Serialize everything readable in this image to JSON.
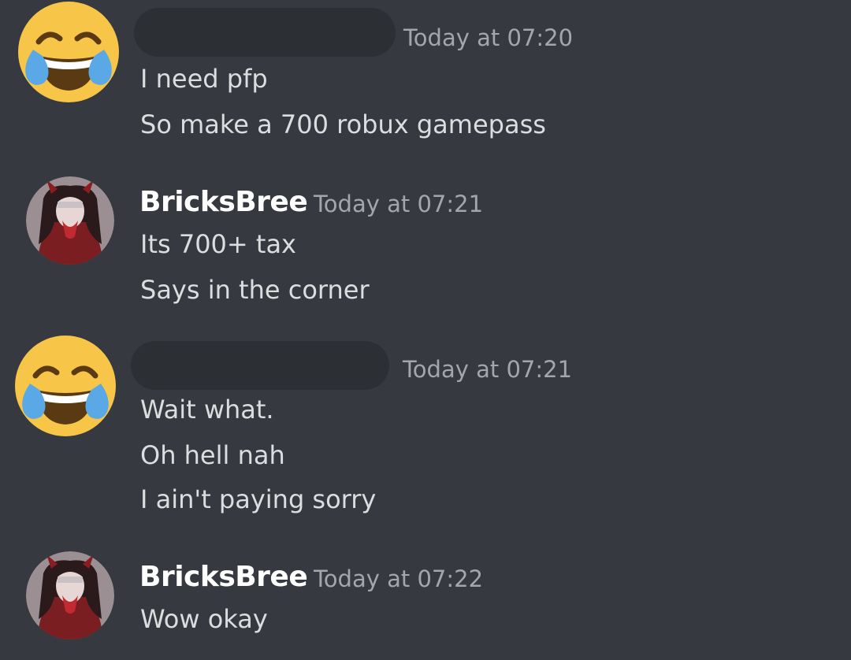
{
  "messages": [
    {
      "author_label": "",
      "avatar": "face-with-tears-of-joy-emoji",
      "timestamp": "Today at 07:20",
      "lines": [
        "I need pfp",
        "So make a 700 robux gamepass"
      ]
    },
    {
      "author_label": "BricksBree",
      "avatar": "anime-demon-girl-avatar",
      "timestamp": "Today at 07:21",
      "lines": [
        "Its 700+ tax",
        "Says in the corner"
      ]
    },
    {
      "author_label": "",
      "avatar": "face-with-tears-of-joy-emoji",
      "timestamp": "Today at 07:21",
      "lines": [
        "Wait what.",
        "Oh hell nah",
        "I ain't paying sorry"
      ]
    },
    {
      "author_label": "BricksBree",
      "avatar": "anime-demon-girl-avatar",
      "timestamp": "Today at 07:22",
      "lines": [
        "Wow okay"
      ]
    }
  ],
  "colors": {
    "background": "#36393f",
    "message_text": "#dcddde",
    "username": "#ffffff",
    "timestamp": "#a3a6aa",
    "redaction": "#2c2f33"
  }
}
